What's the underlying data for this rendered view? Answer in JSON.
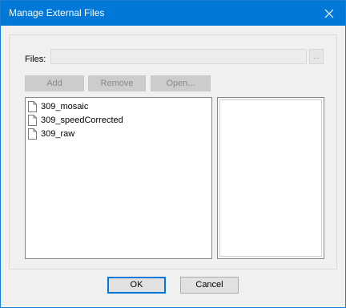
{
  "window": {
    "title": "Manage External Files",
    "close_icon": "close-icon",
    "accent_color": "#0078d7"
  },
  "files_field": {
    "label": "Files:",
    "value": "",
    "browse_label": "..."
  },
  "toolbar": {
    "add_label": "Add",
    "remove_label": "Remove",
    "open_label": "Open..."
  },
  "file_list": {
    "items": [
      {
        "name": "309_mosaic",
        "icon": "document-icon"
      },
      {
        "name": "309_speedCorrected",
        "icon": "document-icon"
      },
      {
        "name": "309_raw",
        "icon": "document-icon"
      }
    ]
  },
  "dialog_buttons": {
    "ok_label": "OK",
    "cancel_label": "Cancel"
  }
}
